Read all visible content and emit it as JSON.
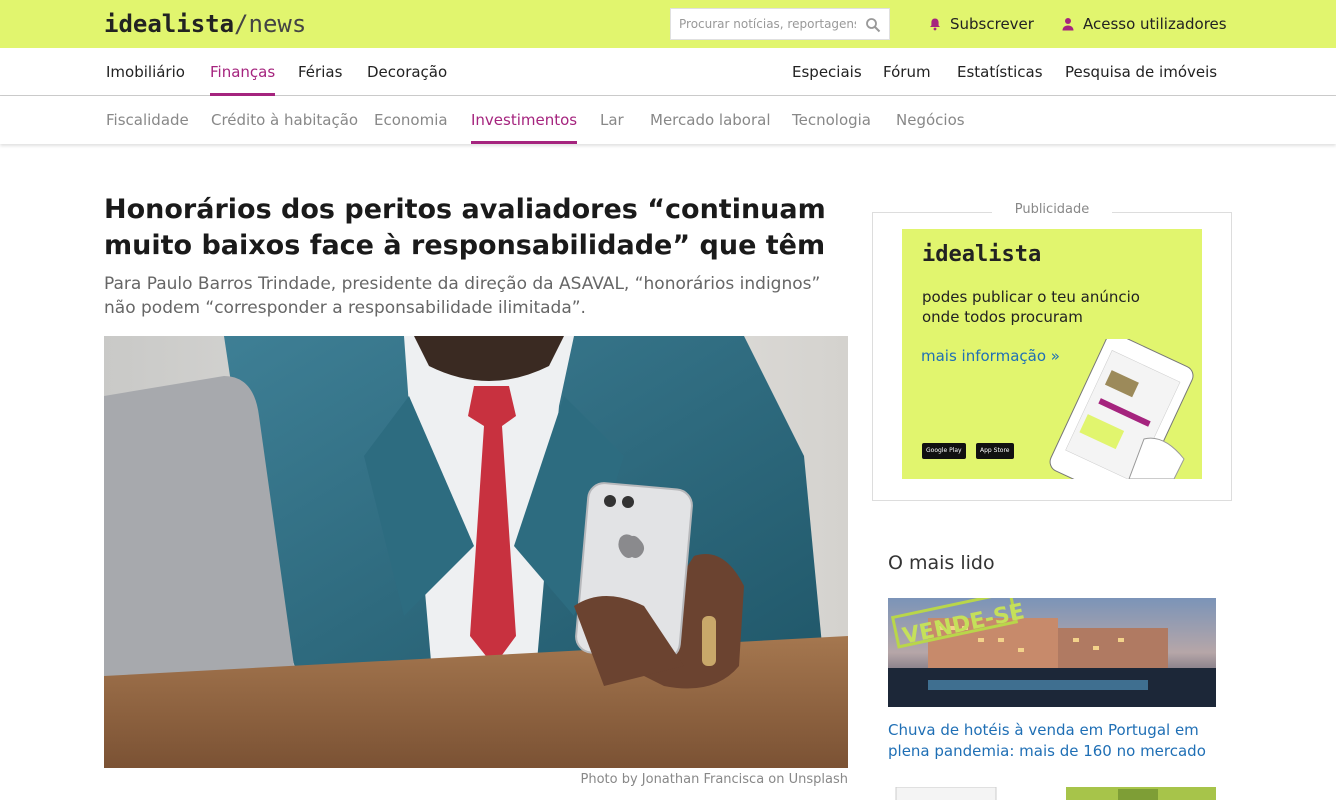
{
  "header": {
    "logo_brand": "idealista",
    "logo_slash": "/",
    "logo_section": "news",
    "search_placeholder": "Procurar notícias, reportagens",
    "subscribe_label": "Subscrever",
    "login_label": "Acesso utilizadores"
  },
  "primary_nav": {
    "left": [
      "Imobiliário",
      "Finanças",
      "Férias",
      "Decoração"
    ],
    "right": [
      "Especiais",
      "Fórum",
      "Estatísticas",
      "Pesquisa de imóveis"
    ],
    "active": "Finanças"
  },
  "secondary_nav": {
    "items": [
      "Fiscalidade",
      "Crédito à habitação",
      "Economia",
      "Investimentos",
      "Lar",
      "Mercado laboral",
      "Tecnologia",
      "Negócios"
    ],
    "active": "Investimentos"
  },
  "article": {
    "headline": "Honorários dos peritos avaliadores “continuam muito baixos face à responsabilidade” que têm",
    "lead": "Para Paulo Barros Trindade, presidente da direção da ASAVAL, “honorários indignos” não podem “corresponder a responsabilidade ilimitada”.",
    "photo_credit": "Photo by Jonathan Francisca on Unsplash"
  },
  "ad": {
    "label": "Publicidade",
    "logo": "idealista",
    "text": "podes publicar o teu anúncio onde todos procuram",
    "cta": "mais informação »",
    "store_badges": [
      "Google Play",
      "App Store"
    ]
  },
  "most_read": {
    "title": "O mais lido",
    "items": [
      {
        "title": "Chuva de hotéis à venda em Portugal em plena pandemia: mais de 160 no mercado",
        "image_sign": "VENDE-SE"
      }
    ]
  },
  "colors": {
    "brand_yellow": "#e1f56e",
    "accent_magenta": "#a5247e",
    "link_blue": "#1f6fb5"
  },
  "icons": [
    "search-icon",
    "bell-icon",
    "user-icon"
  ]
}
